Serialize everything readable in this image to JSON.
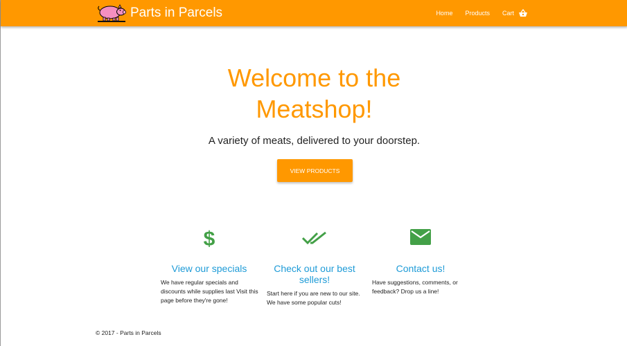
{
  "brand": {
    "name": "Parts in Parcels",
    "logo_icon": "pig-icon"
  },
  "nav": {
    "home": "Home",
    "products": "Products",
    "cart": "Cart",
    "cart_icon": "basket-icon"
  },
  "hero": {
    "title_line1": "Welcome to the",
    "title_line2": "Meatshop!",
    "subtitle": "A variety of meats, delivered to your doorstep.",
    "button": "VIEW PRODUCTS"
  },
  "features": [
    {
      "icon": "dollar-icon",
      "title": "View our specials",
      "text": "We have regular specials and discounts while supplies last Visit this page before they're gone!"
    },
    {
      "icon": "double-check-icon",
      "title": "Check out our best sellers!",
      "text": "Start here if you are new to our site. We have some popular cuts!"
    },
    {
      "icon": "mail-icon",
      "title": "Contact us!",
      "text": "Have suggestions, comments, or feedback? Drop us a line!"
    }
  ],
  "footer": {
    "text": "© 2017 - Parts in Parcels"
  },
  "colors": {
    "accent": "#ff9800",
    "link_blue": "#1e9bd7",
    "icon_green": "#43a047",
    "pig_pink": "#f48fc0"
  }
}
